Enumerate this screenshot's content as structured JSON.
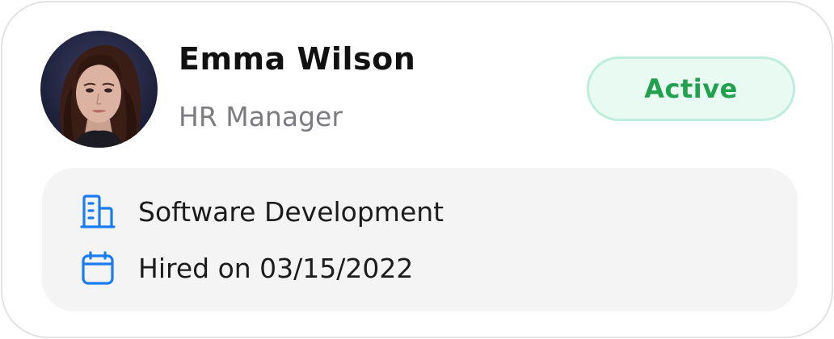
{
  "employee": {
    "name": "Emma Wilson",
    "role": "HR Manager",
    "status": "Active",
    "avatar_icon": "person-photo"
  },
  "details": {
    "department": {
      "icon": "building-icon",
      "text": "Software Development"
    },
    "hired": {
      "icon": "calendar-icon",
      "text": "Hired on 03/15/2022"
    }
  },
  "colors": {
    "status_text": "#21a04e",
    "status_bg": "#e9faf3",
    "status_border": "#bdeedd",
    "icon_accent": "#1a7cf2",
    "details_bg": "#f4f4f4",
    "card_border": "#e2e2e2"
  }
}
